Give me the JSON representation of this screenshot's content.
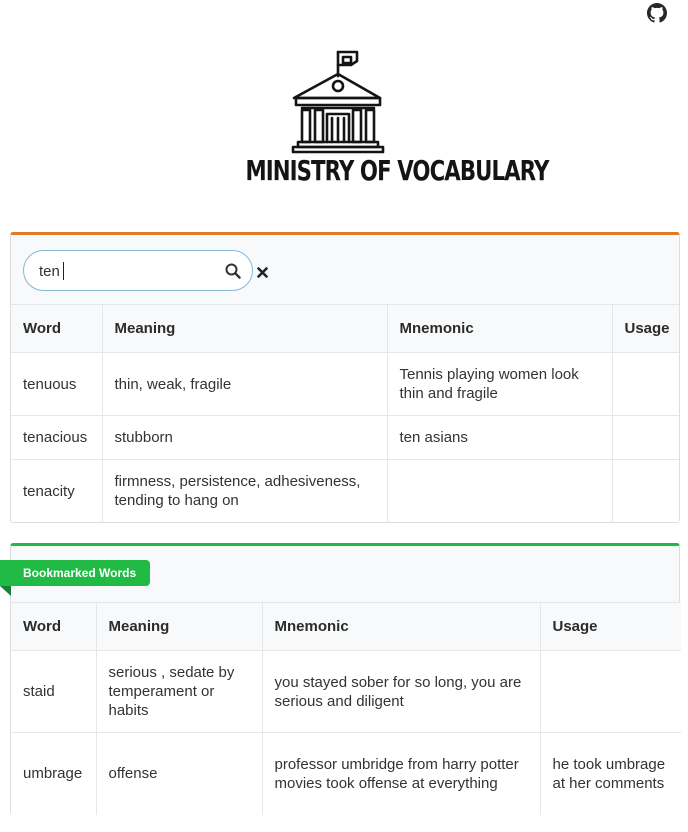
{
  "header": {
    "logo_text": "MINISTRY OF VOCABULARY",
    "github_icon": "github-icon"
  },
  "search": {
    "query": "ten",
    "search_icon": "search-icon",
    "clear_icon": "close-icon",
    "accent_color": "#e07b26",
    "columns": [
      "Word",
      "Meaning",
      "Mnemonic",
      "Usage"
    ],
    "rows": [
      {
        "word": "tenuous",
        "meaning": "thin, weak, fragile",
        "mnemonic": "Tennis playing women look thin and fragile",
        "usage": ""
      },
      {
        "word": "tenacious",
        "meaning": "stubborn",
        "mnemonic": "ten asians",
        "usage": ""
      },
      {
        "word": "tenacity",
        "meaning": "firmness, persistence, adhesiveness, tending to hang on",
        "mnemonic": "",
        "usage": ""
      }
    ]
  },
  "bookmarks": {
    "ribbon_label": "Bookmarked Words",
    "accent_color": "#21ba45",
    "columns": [
      "Word",
      "Meaning",
      "Mnemonic",
      "Usage"
    ],
    "rows": [
      {
        "word": "staid",
        "meaning": "serious , sedate by temperament or habits",
        "mnemonic": "you stayed sober for so long, you are serious and diligent",
        "usage": ""
      },
      {
        "word": "umbrage",
        "meaning": "offense",
        "mnemonic": "professor umbridge from harry potter movies took offense at everything",
        "usage": "he took umbrage at her comments"
      }
    ]
  }
}
